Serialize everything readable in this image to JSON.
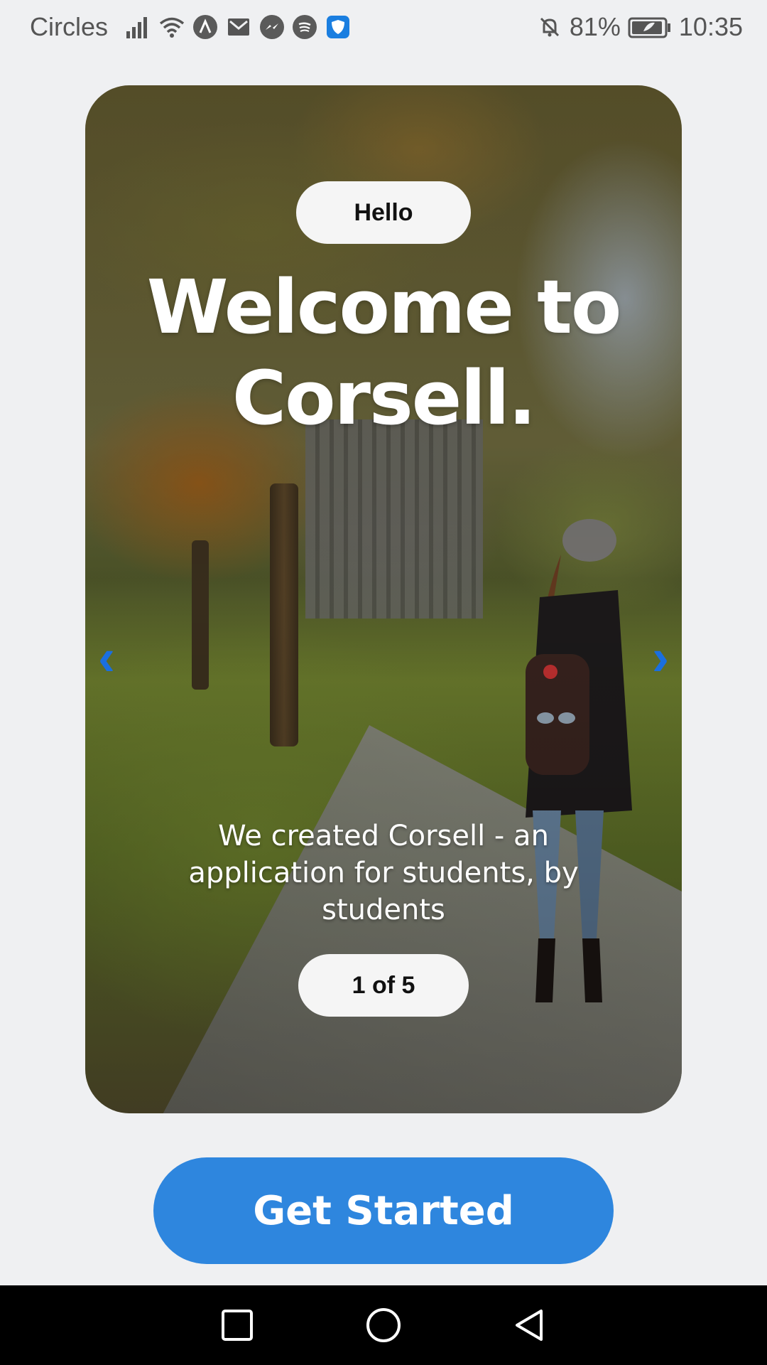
{
  "status_bar": {
    "carrier": "Circles",
    "battery": "81%",
    "time": "10:35",
    "icons": [
      "signal-icon",
      "wifi-icon",
      "app-a-icon",
      "mail-icon",
      "messenger-icon",
      "spotify-icon",
      "shield-icon",
      "mute-bell-icon",
      "battery-icon"
    ]
  },
  "card": {
    "tag": "Hello",
    "title": "Welcome to Corsell.",
    "subtitle": "We created Corsell - an application for students, by students",
    "pager": "1 of 5",
    "prev_icon": "chevron-left-icon",
    "next_icon": "chevron-right-icon",
    "arrow_color": "#1a6fe0"
  },
  "cta": {
    "label": "Get Started",
    "color": "#2e86de"
  },
  "nav_bar": {
    "buttons": [
      "recents-square-icon",
      "home-circle-icon",
      "back-triangle-icon"
    ]
  }
}
